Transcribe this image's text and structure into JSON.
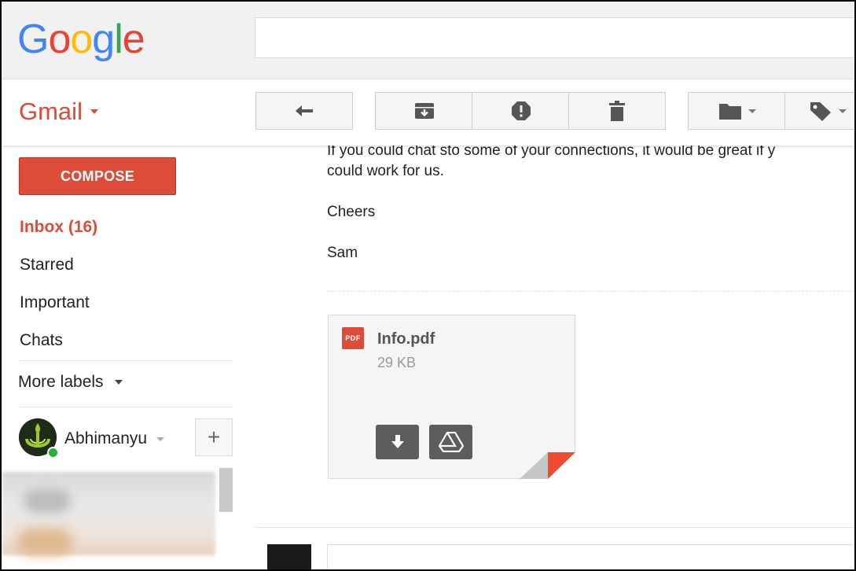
{
  "header": {
    "logo_letters": [
      {
        "ch": "G",
        "color": "#4285F4"
      },
      {
        "ch": "o",
        "color": "#EA4335"
      },
      {
        "ch": "o",
        "color": "#FBBC05"
      },
      {
        "ch": "g",
        "color": "#4285F4"
      },
      {
        "ch": "l",
        "color": "#34A853"
      },
      {
        "ch": "e",
        "color": "#EA4335"
      }
    ],
    "search_value": ""
  },
  "app": {
    "name": "Gmail",
    "brand_color": "#dd4b39"
  },
  "toolbar": {
    "reply_icon": "reply-icon",
    "archive_icon": "archive-icon",
    "spam_icon": "report-spam-icon",
    "delete_icon": "delete-icon",
    "move_icon": "folder-icon",
    "labels_icon": "label-icon"
  },
  "sidebar": {
    "compose_label": "COMPOSE",
    "items": [
      {
        "label": "Inbox (16)",
        "active": true
      },
      {
        "label": "Starred",
        "active": false
      },
      {
        "label": "Important",
        "active": false
      },
      {
        "label": "Chats",
        "active": false
      }
    ],
    "more_labels": "More labels",
    "user_name": "Abhimanyu",
    "add_symbol": "+",
    "online_color": "#1fb33c"
  },
  "message": {
    "lines": [
      "If you could chat sto some of your connections, it would be great if y",
      "could work for us.",
      "Cheers",
      "Sam"
    ],
    "attachment": {
      "type_badge": "PDF",
      "file_name": "Info.pdf",
      "file_size": "29 KB",
      "download_icon": "download-icon",
      "drive_icon": "google-drive-icon"
    }
  }
}
